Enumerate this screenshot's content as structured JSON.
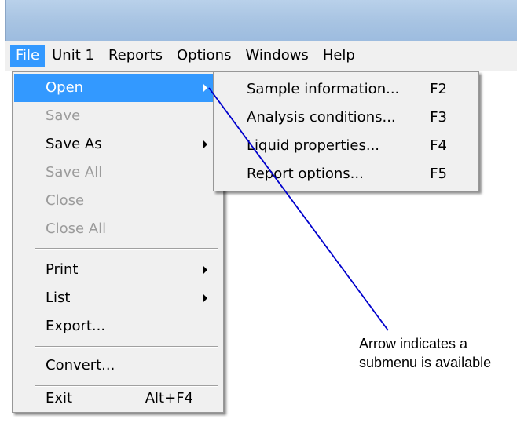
{
  "menubar": {
    "items": [
      "File",
      "Unit 1",
      "Reports",
      "Options",
      "Windows",
      "Help"
    ]
  },
  "file_menu": {
    "items": [
      {
        "label": "Open",
        "submenu": true,
        "state": "highlighted"
      },
      {
        "label": "Save",
        "state": "disabled"
      },
      {
        "label": "Save As",
        "submenu": true
      },
      {
        "label": "Save All",
        "state": "disabled"
      },
      {
        "label": "Close",
        "state": "disabled"
      },
      {
        "label": "Close All",
        "state": "disabled"
      },
      {
        "label": "Print",
        "submenu": true
      },
      {
        "label": "List",
        "submenu": true
      },
      {
        "label": "Export..."
      },
      {
        "label": "Convert..."
      },
      {
        "label": "Exit",
        "shortcut": "Alt+F4"
      }
    ]
  },
  "submenu": {
    "items": [
      {
        "label": "Sample information...",
        "shortcut": "F2"
      },
      {
        "label": "Analysis conditions...",
        "shortcut": "F3"
      },
      {
        "label": "Liquid properties...",
        "shortcut": "F4"
      },
      {
        "label": "Report options...",
        "shortcut": "F5"
      }
    ]
  },
  "annotation": {
    "line1": "Arrow indicates a",
    "line2": "submenu is available"
  },
  "colors": {
    "highlight": "#3399ff",
    "pointer_line": "#0000cc",
    "disabled_text": "#9b9b9b"
  }
}
